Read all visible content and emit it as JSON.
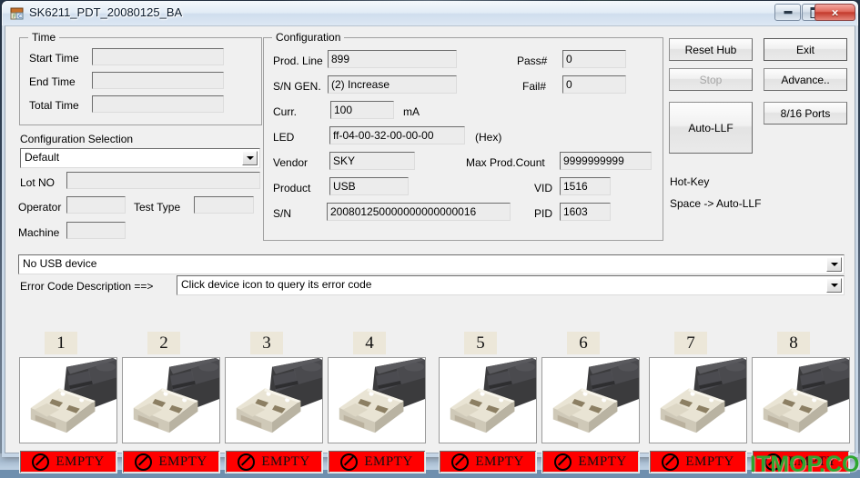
{
  "window": {
    "title": "SK6211_PDT_20080125_BA",
    "icon": "app-blocks-icon",
    "minimize_label": "Minimize",
    "maximize_label": "Maximize",
    "close_label": "×"
  },
  "time_group": {
    "legend": "Time",
    "rows": [
      {
        "label": "Start Time",
        "value": ""
      },
      {
        "label": "End Time",
        "value": ""
      },
      {
        "label": "Total Time",
        "value": ""
      }
    ]
  },
  "config_selection": {
    "label": "Configuration Selection",
    "selected": "Default",
    "lot_no_label": "Lot NO",
    "lot_no_value": "",
    "operator_label": "Operator",
    "operator_value": "",
    "test_type_label": "Test Type",
    "test_type_value": "",
    "machine_label": "Machine",
    "machine_value": ""
  },
  "configuration": {
    "legend": "Configuration",
    "prod_line_label": "Prod. Line",
    "prod_line_value": "899",
    "sn_gen_label": "S/N GEN.",
    "sn_gen_value": "(2) Increase",
    "curr_label": "Curr.",
    "curr_value": "100",
    "curr_unit": "mA",
    "led_label": "LED",
    "led_value": "ff-04-00-32-00-00-00",
    "led_hint": "(Hex)",
    "vendor_label": "Vendor",
    "vendor_value": "SKY",
    "product_label": "Product",
    "product_value": "USB",
    "sn_label": "S/N",
    "sn_value": "200801250000000000000016",
    "pass_label": "Pass#",
    "pass_value": "0",
    "fail_label": "Fail#",
    "fail_value": "0",
    "max_prod_count_label": "Max Prod.Count",
    "max_prod_count_value": "9999999999",
    "vid_label": "VID",
    "vid_value": "1516",
    "pid_label": "PID",
    "pid_value": "1603"
  },
  "actions": {
    "reset_hub": "Reset Hub",
    "exit": "Exit",
    "stop": "Stop",
    "advance": "Advance..",
    "auto_llf": "Auto-LLF",
    "ports": "8/16 Ports",
    "hotkey_title": "Hot-Key",
    "hotkey_line": "Space -> Auto-LLF"
  },
  "status": {
    "device_combo_value": "No USB device",
    "error_label": "Error Code Description ==>",
    "error_combo_value": "Click device icon to query its error code"
  },
  "devices": [
    {
      "number": "1",
      "status": "EMPTY",
      "icon": "no-entry-icon",
      "image": "usb-flash-drive-photo"
    },
    {
      "number": "2",
      "status": "EMPTY",
      "icon": "no-entry-icon",
      "image": "usb-flash-drive-photo"
    },
    {
      "number": "3",
      "status": "EMPTY",
      "icon": "no-entry-icon",
      "image": "usb-flash-drive-photo"
    },
    {
      "number": "4",
      "status": "EMPTY",
      "icon": "no-entry-icon",
      "image": "usb-flash-drive-photo"
    },
    {
      "number": "5",
      "status": "EMPTY",
      "icon": "no-entry-icon",
      "image": "usb-flash-drive-photo"
    },
    {
      "number": "6",
      "status": "EMPTY",
      "icon": "no-entry-icon",
      "image": "usb-flash-drive-photo"
    },
    {
      "number": "7",
      "status": "EMPTY",
      "icon": "no-entry-icon",
      "image": "usb-flash-drive-photo"
    },
    {
      "number": "8",
      "status": "EMPTY",
      "icon": "no-entry-icon",
      "image": "usb-flash-drive-photo"
    }
  ],
  "watermark": "ITMOP.COM",
  "colors": {
    "status_empty_bg": "#FF0000",
    "device_number_bg": "#ECE7D9",
    "client_bg": "#F0F0F0",
    "field_bg": "#ECECEC",
    "watermark": "#2EA62E"
  }
}
